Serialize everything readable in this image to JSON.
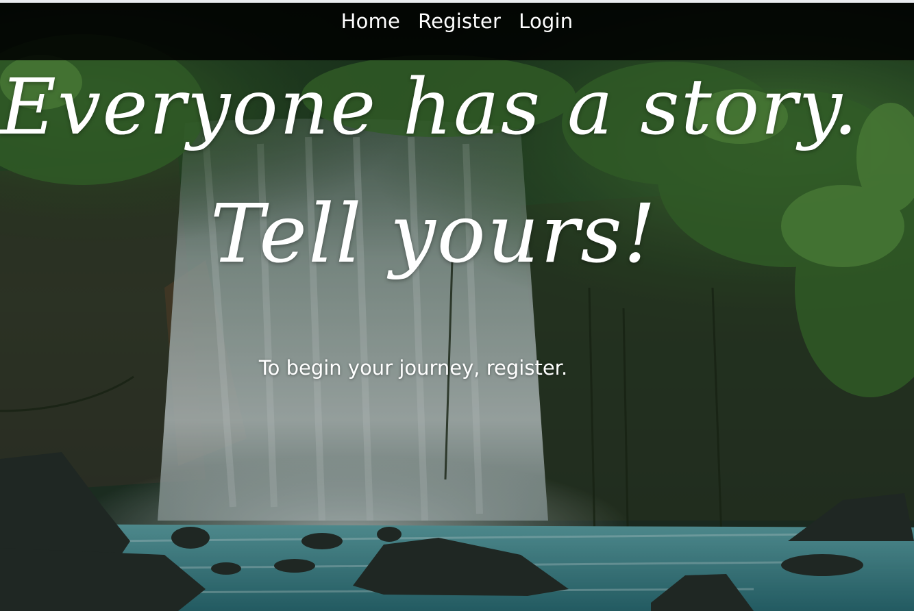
{
  "nav": {
    "items": [
      {
        "label": "Home"
      },
      {
        "label": "Register"
      },
      {
        "label": "Login"
      }
    ]
  },
  "hero": {
    "headline_line1": "Everyone has a story.",
    "headline_line2": "Tell yours!",
    "subtitle_prefix": "To begin your journey, ",
    "subtitle_link": "register",
    "subtitle_suffix": "."
  },
  "colors": {
    "navbar_bg": "#000000",
    "text": "#ffffff",
    "foliage": "#2f5a2b",
    "water": "#3c8e95",
    "mist": "#b8c7c6"
  },
  "background": {
    "icon": "waterfall-forest-photo"
  }
}
